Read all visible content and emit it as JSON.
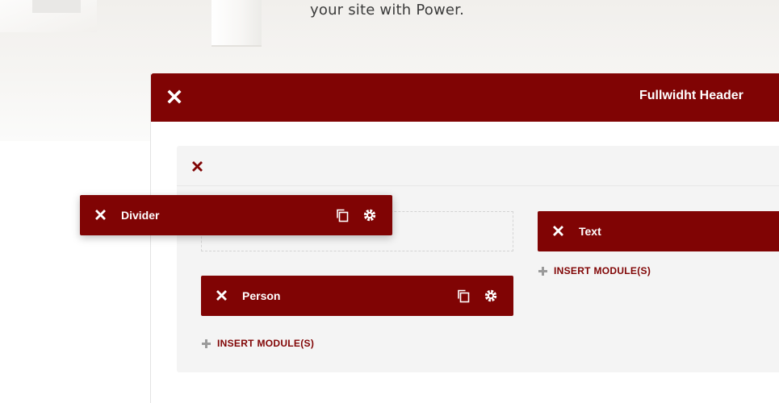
{
  "hero": {
    "text": "your site with Power."
  },
  "section": {
    "title": "Fullwidht Header"
  },
  "modules": {
    "divider": "Divider",
    "person": "Person",
    "text": "Text"
  },
  "insert": {
    "label_left": "INSERT MODULE(S)",
    "label_right": "INSERT MODULE(S)"
  },
  "colors": {
    "accent": "#800404",
    "row_bg": "#f4f4f4",
    "plus": "#9a9a9a"
  },
  "icons": {
    "close": "close-icon",
    "copy": "copy-icon",
    "settings": "gear-icon",
    "plus": "plus-icon"
  }
}
